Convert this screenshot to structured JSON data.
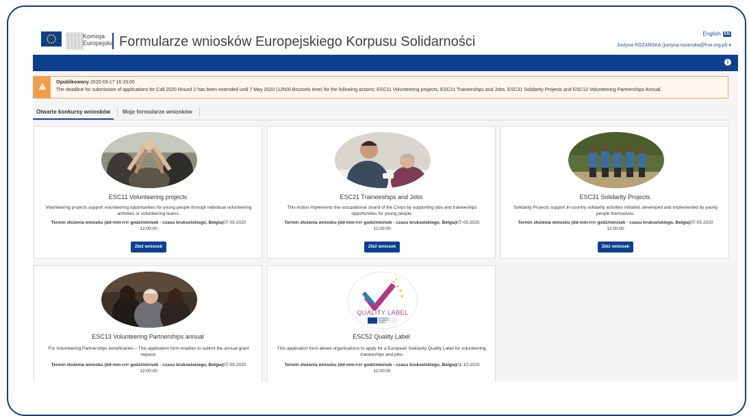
{
  "header": {
    "logo_line1": "Komisja",
    "logo_line2": "Europejska",
    "title": "Formularze wniosków Europejskiego Korpusu Solidarności",
    "language": "English",
    "language_code": "EN",
    "user": "Justyna RÓŻAŃSKA (justyna.rozanska@frse.org.pl) ▾"
  },
  "notice": {
    "published_label": "Opublikowany",
    "published_date": " 2020-03-17 16:15:00",
    "message": "The deadline for submission of applications for Call 2020 Round 2 has been extended until 7 May 2020 (12h00 Brussels time) for the following actions: ESC11 Volunteering projects, ESC21 Traineeships and Jobs, ESC31 Solidarity Projects and ESC13 Volunteering Partnerships Annual."
  },
  "tabs": [
    {
      "label": "Otwarte konkursy wniosków",
      "active": true
    },
    {
      "label": "Moje formularze wniosków",
      "active": false
    }
  ],
  "deadline_label": "Termin złożenia wniosku (dd-mm-rrrr godz/min/sek - czasu brukselskiego, Belgia)",
  "apply_label": "Złóż wniosek",
  "cards": [
    {
      "title": "ESC11 Volunteering projects",
      "desc": "Volunteering projects support volunteering opportunities for young people through individual volunteering activities or volunteering teams.",
      "deadline_value": "07-05-2020 12:00:00"
    },
    {
      "title": "ESC21 Traineeships and Jobs",
      "desc": "This Action implements the occupational strand of the Corps by supporting jobs and traineeships opportunities for young people.",
      "deadline_value": "07-05-2020 12:00:00"
    },
    {
      "title": "ESC31 Solidarity Projects",
      "desc": "Solidarity Projects support in-country solidarity activities initiated, developed and implemented by young people themselves.",
      "deadline_value": "07-05-2020 12:00:00"
    },
    {
      "title": "ESC13 Volunteering Partnerships annual",
      "desc": "For Volunteering Partnerships beneficiaries – This application form enables to submit the annual grant request.",
      "deadline_value": "07-05-2020 12:00:00"
    },
    {
      "title": "ESC52 Quality Label",
      "desc": "This application form allows organisations to apply for a European Solidarity Quality Label for volunteering, traineeships and jobs.",
      "deadline_value": "01-10-2020 12:00:00",
      "badge_main": "QUALITY LABEL",
      "badge_sub1": "EUROPEAN",
      "badge_sub2": "SOLIDARITY",
      "badge_sub3": "CORPS"
    }
  ],
  "colors": {
    "brand_blue": "#0d3f8f",
    "warning_orange": "#f0a04c"
  }
}
